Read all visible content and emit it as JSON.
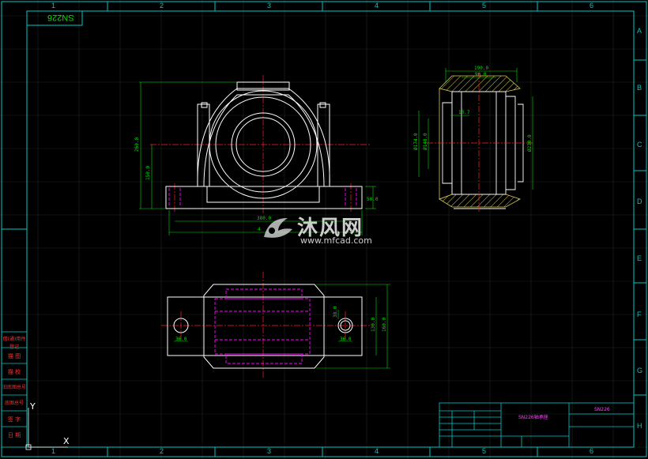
{
  "drawing": {
    "title_box_text": "SN226",
    "column_labels": [
      "1",
      "2",
      "3",
      "4",
      "5",
      "6"
    ],
    "row_labels": [
      "A",
      "B",
      "C",
      "D",
      "E",
      "F",
      "G",
      "H"
    ],
    "side_labels": [
      "借(通)用件登记",
      "描 图",
      "描 校",
      "旧底图总号",
      "底图总号",
      "签 字",
      "日 期"
    ],
    "axis_labels": {
      "y": "Y",
      "x": "X"
    }
  },
  "front_view": {
    "dimensions": {
      "height_total": "260.0",
      "center_height": "150.0",
      "base_thickness": "50.0",
      "bolt_spacing": "380.0",
      "overall_length": "4"
    }
  },
  "section_view": {
    "dimensions": {
      "width_outer": "190.0",
      "width_inner": "90.0",
      "groove": "13.7",
      "dia_left_1": "Ø174.0",
      "dia_left_2": "Ø148.0",
      "dia_outer": "Ø230.0"
    }
  },
  "top_view": {
    "dimensions": {
      "bolt_hole_left": "36.0",
      "bolt_hole_right": "36.0",
      "slot": "38.0",
      "width_inner": "130.0",
      "width_outer": "160.0"
    }
  },
  "title_block": {
    "name": "SN226轴承座",
    "code": "SN226"
  },
  "watermark": {
    "text": "沐风网",
    "url": "www.mfcad.com"
  },
  "colors": {
    "background": "#000000",
    "border": "#00c8c8",
    "outline": "#ffffff",
    "hidden": "#ff00ff",
    "center": "#ff2020",
    "dimension": "#00e000",
    "hatch": "#d8c850"
  }
}
